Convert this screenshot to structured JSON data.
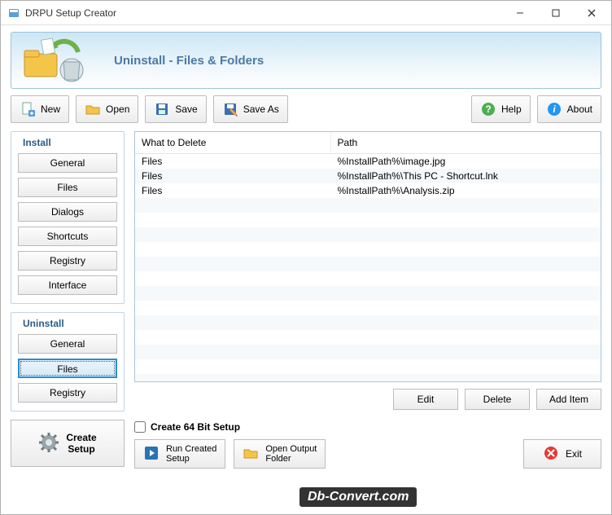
{
  "window": {
    "title": "DRPU Setup Creator"
  },
  "banner": {
    "title": "Uninstall - Files & Folders"
  },
  "toolbar": {
    "new": "New",
    "open": "Open",
    "save": "Save",
    "saveas": "Save As",
    "help": "Help",
    "about": "About"
  },
  "install": {
    "title": "Install",
    "items": [
      "General",
      "Files",
      "Dialogs",
      "Shortcuts",
      "Registry",
      "Interface"
    ]
  },
  "uninstall": {
    "title": "Uninstall",
    "items": [
      "General",
      "Files",
      "Registry"
    ],
    "active": "Files"
  },
  "create": {
    "label": "Create\nSetup"
  },
  "table": {
    "headers": [
      "What to Delete",
      "Path"
    ],
    "rows": [
      {
        "what": "Files",
        "path": "%InstallPath%\\image.jpg"
      },
      {
        "what": "Files",
        "path": "%InstallPath%\\This PC - Shortcut.lnk"
      },
      {
        "what": "Files",
        "path": "%InstallPath%\\Analysis.zip"
      }
    ]
  },
  "actions": {
    "edit": "Edit",
    "delete": "Delete",
    "add": "Add Item"
  },
  "bottom": {
    "checkbox": "Create 64 Bit Setup",
    "run": "Run Created\nSetup",
    "openout": "Open Output\nFolder",
    "exit": "Exit"
  },
  "watermark": "Db-Convert.com"
}
